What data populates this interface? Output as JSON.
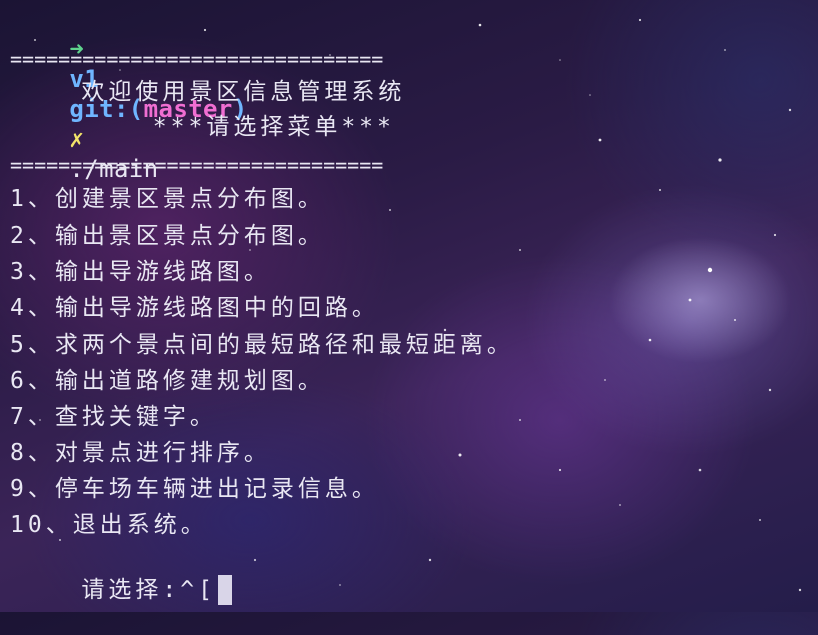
{
  "prompt": {
    "arrow": "➜",
    "dir": "v1",
    "git_label": "git:(",
    "branch": "master",
    "git_close": ")",
    "dirty_mark": "✗",
    "command": "./main"
  },
  "menu": {
    "rule": "===============================",
    "title": "    欢迎使用景区信息管理系统",
    "subtitle": "        ***请选择菜单***",
    "items": [
      "1、创建景区景点分布图。",
      "2、输出景区景点分布图。",
      "3、输出导游线路图。",
      "4、输出导游线路图中的回路。",
      "5、求两个景点间的最短路径和最短距离。",
      "6、输出道路修建规划图。",
      "7、查找关键字。",
      "8、对景点进行排序。",
      "9、停车场车辆进出记录信息。",
      "10、退出系统。"
    ],
    "input_prompt": "请选择:^["
  },
  "colors": {
    "arrow": "#5fd38d",
    "dir": "#6fb5ff",
    "branch": "#f06ed2",
    "dirty_mark": "#f3e46a",
    "text": "#e9e7f3"
  }
}
